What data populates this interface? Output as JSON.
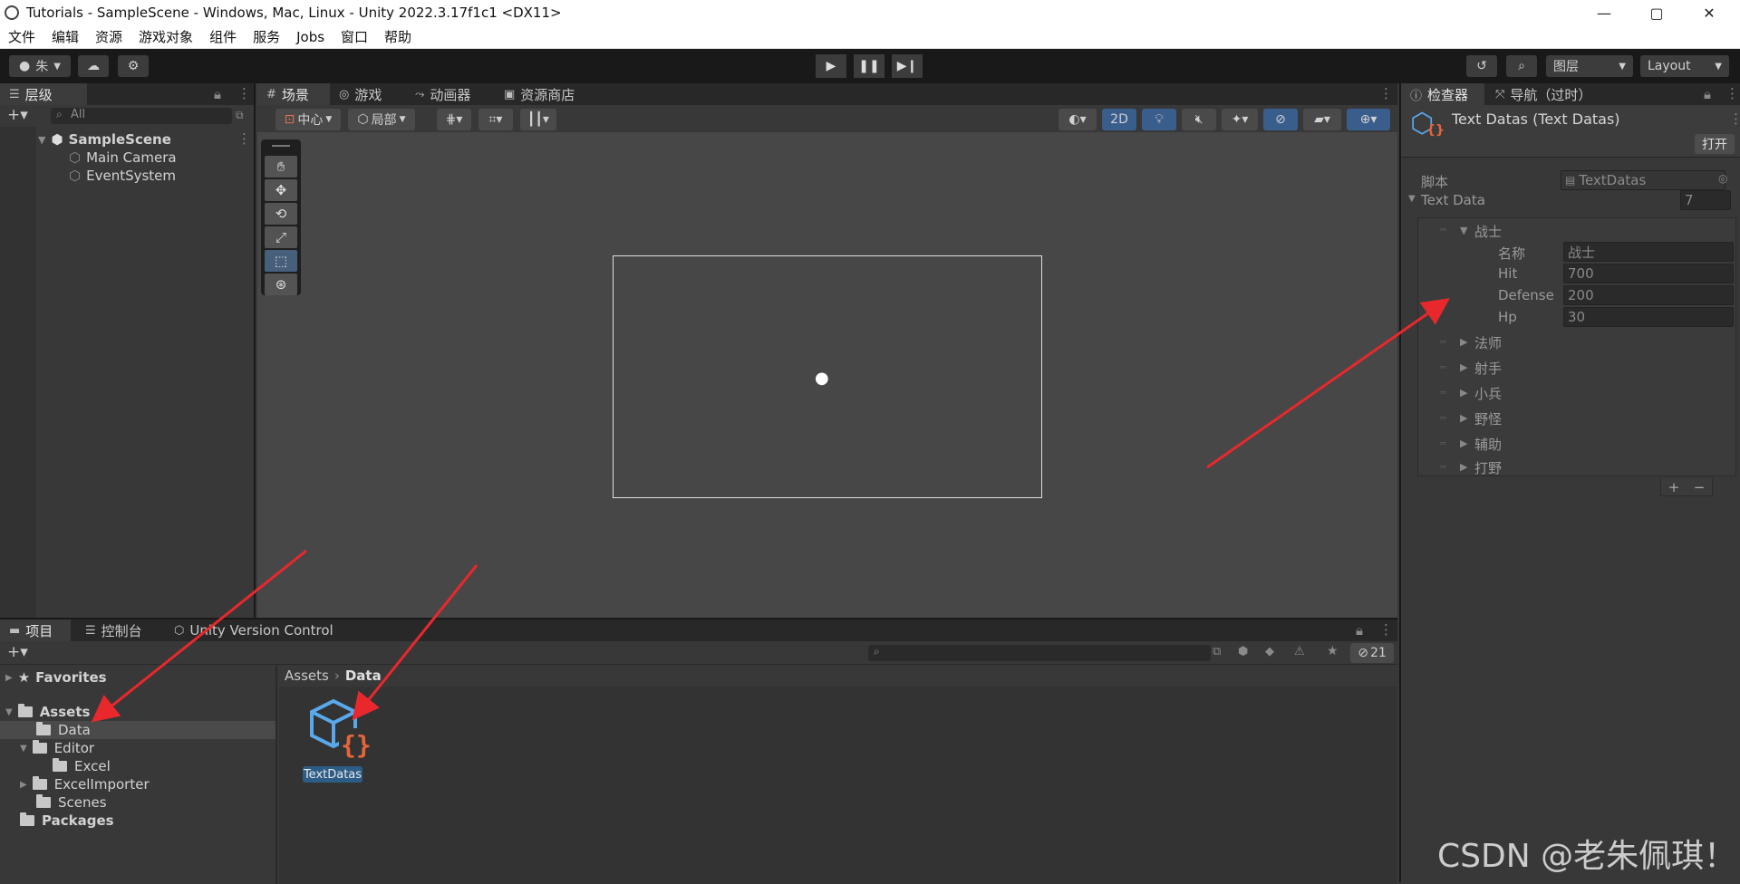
{
  "window": {
    "title": "Tutorials - SampleScene - Windows, Mac, Linux - Unity 2022.3.17f1c1 <DX11>",
    "controls": [
      "—",
      "▢",
      "✕"
    ]
  },
  "menu": [
    "文件",
    "编辑",
    "资源",
    "游戏对象",
    "组件",
    "服务",
    "Jobs",
    "窗口",
    "帮助"
  ],
  "toolbar": {
    "account": "朱",
    "layers_label": "图层",
    "layout_label": "Layout"
  },
  "hierarchy": {
    "tab_label": "层级",
    "search_placeholder": "All",
    "scene_name": "SampleScene",
    "objects": [
      "Main Camera",
      "EventSystem"
    ]
  },
  "scene_tabs": [
    "场景",
    "游戏",
    "动画器",
    "资源商店"
  ],
  "scene_toolbar": {
    "pivot_label": "中心",
    "space_label": "局部",
    "mode_2d": "2D"
  },
  "inspector": {
    "tabs": [
      "检查器",
      "导航（过时）"
    ],
    "title": "Text Datas (Text Datas)",
    "open_button": "打开",
    "script_label": "脚本",
    "script_value": "TextDatas",
    "list_label": "Text Data",
    "list_count": "7",
    "expanded": {
      "name": "战士",
      "fields": [
        {
          "label": "名称",
          "value": "战士"
        },
        {
          "label": "Hit",
          "value": "700"
        },
        {
          "label": "Defense",
          "value": "200"
        },
        {
          "label": "Hp",
          "value": "30"
        }
      ]
    },
    "collapsed": [
      "法师",
      "射手",
      "小兵",
      "野怪",
      "辅助",
      "打野"
    ],
    "add_btn": "+",
    "remove_btn": "−"
  },
  "project": {
    "tabs": [
      "项目",
      "控制台",
      "Unity Version Control"
    ],
    "hidden_count": "21",
    "breadcrumb": [
      "Assets",
      "Data"
    ],
    "favorites": "Favorites",
    "assets": "Assets",
    "tree": [
      "Data",
      "Editor",
      "Excel",
      "ExcelImporter",
      "Scenes"
    ],
    "packages": "Packages",
    "asset_item": "TextDatas"
  },
  "watermark": "CSDN @老朱佩琪！",
  "colors": {
    "accent_blue": "#3a5e8c",
    "arrow_red": "#e8282c",
    "asset_cube_blue": "#5aa8ec",
    "asset_brace_orange": "#e6653a"
  }
}
